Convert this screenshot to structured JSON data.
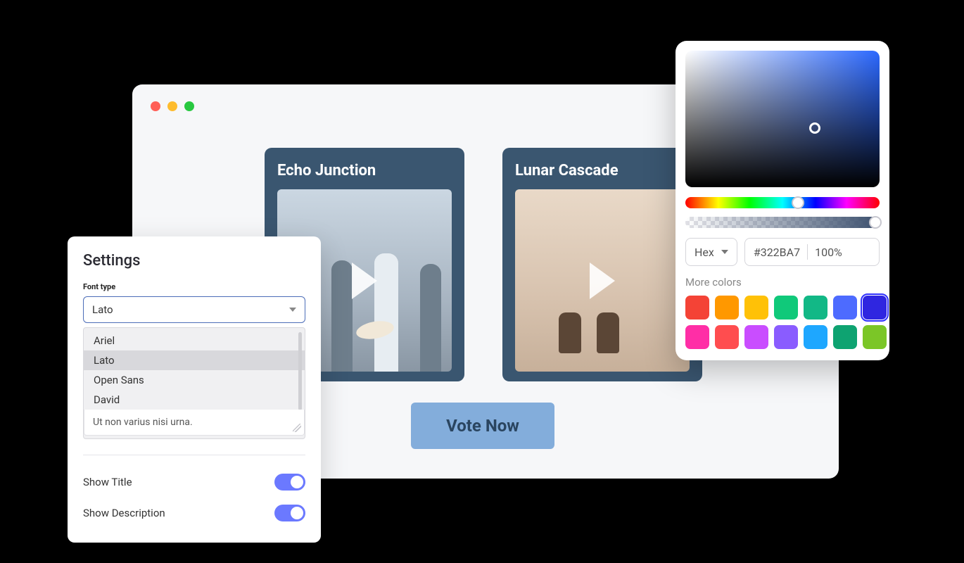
{
  "browser": {
    "cards": [
      {
        "title": "Echo Junction"
      },
      {
        "title": "Lunar Cascade"
      }
    ],
    "vote_label": "Vote Now"
  },
  "settings": {
    "title": "Settings",
    "font_label": "Font type",
    "font_selected": "Lato",
    "font_options": [
      "Ariel",
      "Lato",
      "Open Sans",
      "David"
    ],
    "note_text": "Ut non varius nisi urna.",
    "toggles": {
      "show_title_label": "Show Title",
      "show_title_on": true,
      "show_description_label": "Show Description",
      "show_description_on": true
    }
  },
  "picker": {
    "format": "Hex",
    "hex_value": "#322BA7",
    "alpha_value": "100%",
    "more_label": "More colors",
    "hue_handle_pct": 58,
    "alpha_handle_pct": 98,
    "swatches": [
      {
        "hex": "#f44336",
        "selected": false
      },
      {
        "hex": "#ff9800",
        "selected": false
      },
      {
        "hex": "#ffc107",
        "selected": false
      },
      {
        "hex": "#10c97a",
        "selected": false
      },
      {
        "hex": "#12b886",
        "selected": false
      },
      {
        "hex": "#4d6bff",
        "selected": false
      },
      {
        "hex": "#2f26e0",
        "selected": true
      },
      {
        "hex": "#ff2ea6",
        "selected": false
      },
      {
        "hex": "#ff4d4f",
        "selected": false
      },
      {
        "hex": "#c94dff",
        "selected": false
      },
      {
        "hex": "#8a5cff",
        "selected": false
      },
      {
        "hex": "#1ea7ff",
        "selected": false
      },
      {
        "hex": "#0ea371",
        "selected": false
      },
      {
        "hex": "#7bc627",
        "selected": false
      }
    ]
  }
}
